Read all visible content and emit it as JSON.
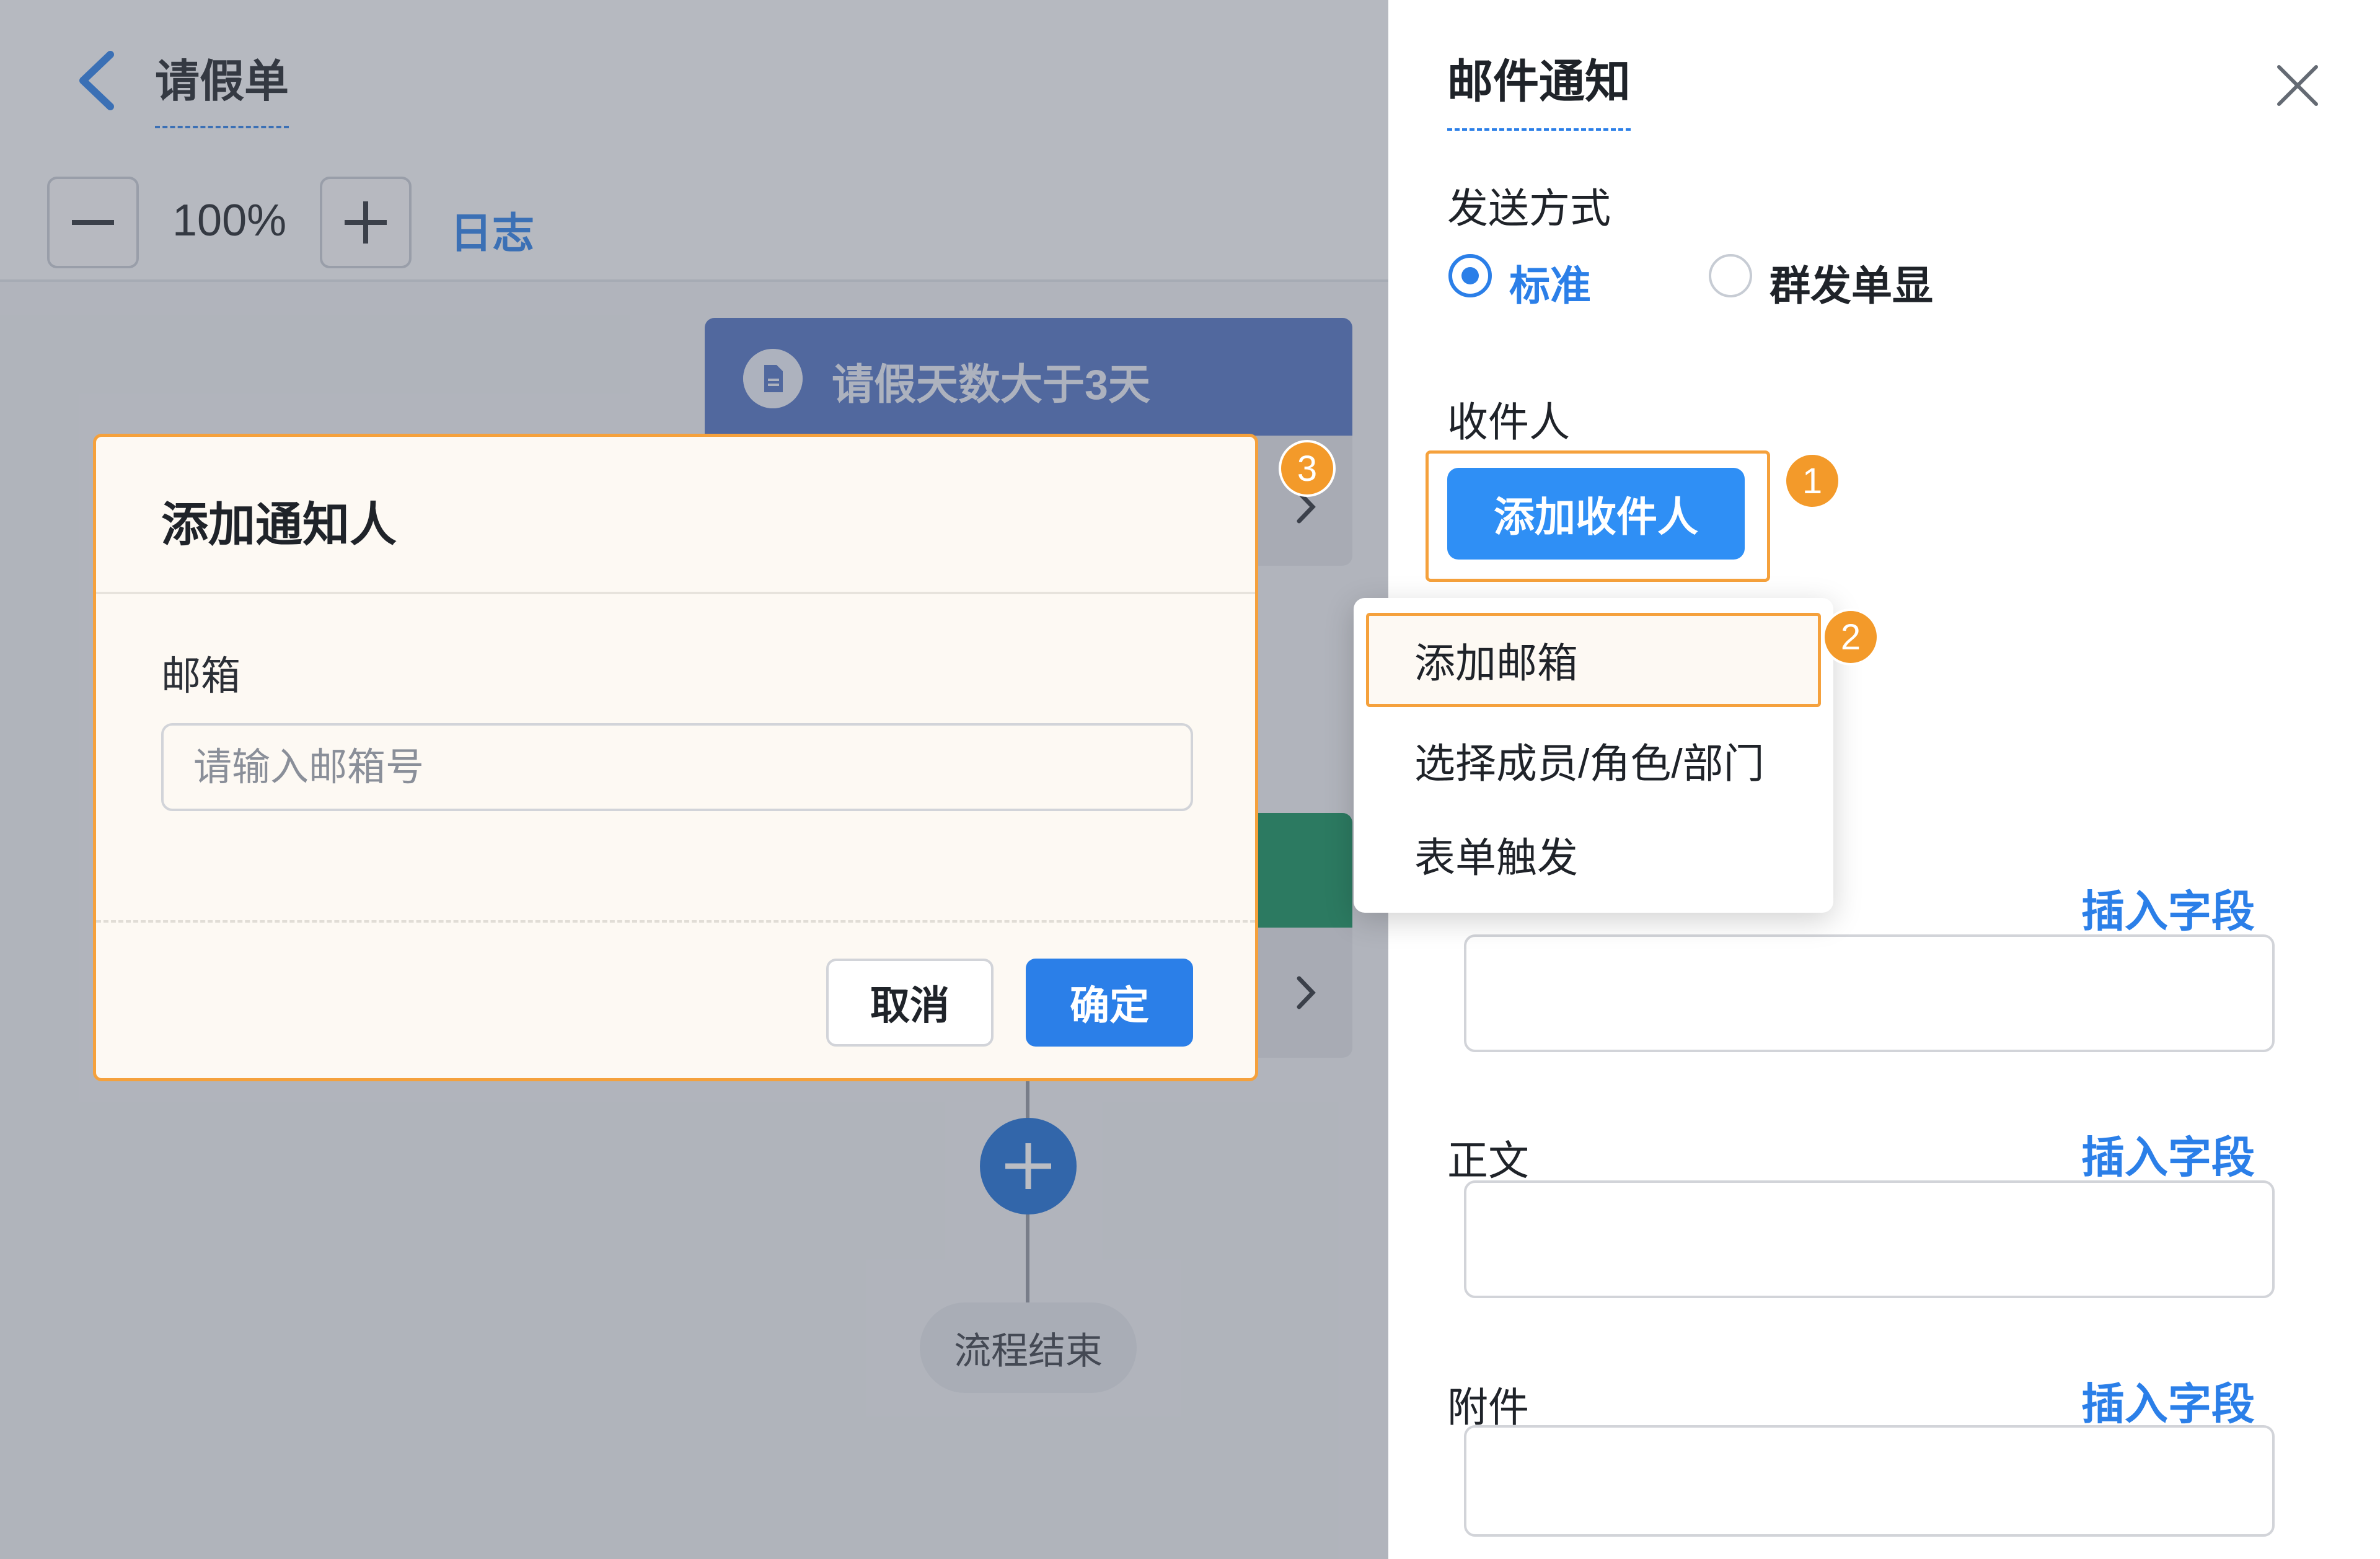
{
  "header": {
    "title": "请假单"
  },
  "toolbar": {
    "zoom": "100%",
    "log_label": "日志"
  },
  "flow": {
    "condition_label": "请假天数大于3天",
    "end_label": "流程结束"
  },
  "modal": {
    "title": "添加通知人",
    "email_label": "邮箱",
    "email_placeholder": "请输入邮箱号",
    "email_value": "",
    "cancel_label": "取消",
    "ok_label": "确定"
  },
  "panel": {
    "title": "邮件通知",
    "send_mode_label": "发送方式",
    "send_modes": [
      {
        "label": "标准",
        "selected": true
      },
      {
        "label": "群发单显",
        "selected": false
      }
    ],
    "recipient_label": "收件人",
    "add_recipient_label": "添加收件人",
    "insert_field_label": "插入字段",
    "body_label": "正文",
    "attachment_label": "附件"
  },
  "dropdown": {
    "items": [
      {
        "label": "添加邮箱",
        "highlighted": true
      },
      {
        "label": "选择成员/角色/部门",
        "highlighted": false
      },
      {
        "label": "表单触发",
        "highlighted": false
      }
    ]
  },
  "badges": [
    "1",
    "2",
    "3"
  ],
  "colors": {
    "accent_blue": "#2b7fe8",
    "highlight_orange": "#f5a13c",
    "condition_node": "#4f72c2",
    "approval_node": "#118f5c"
  }
}
